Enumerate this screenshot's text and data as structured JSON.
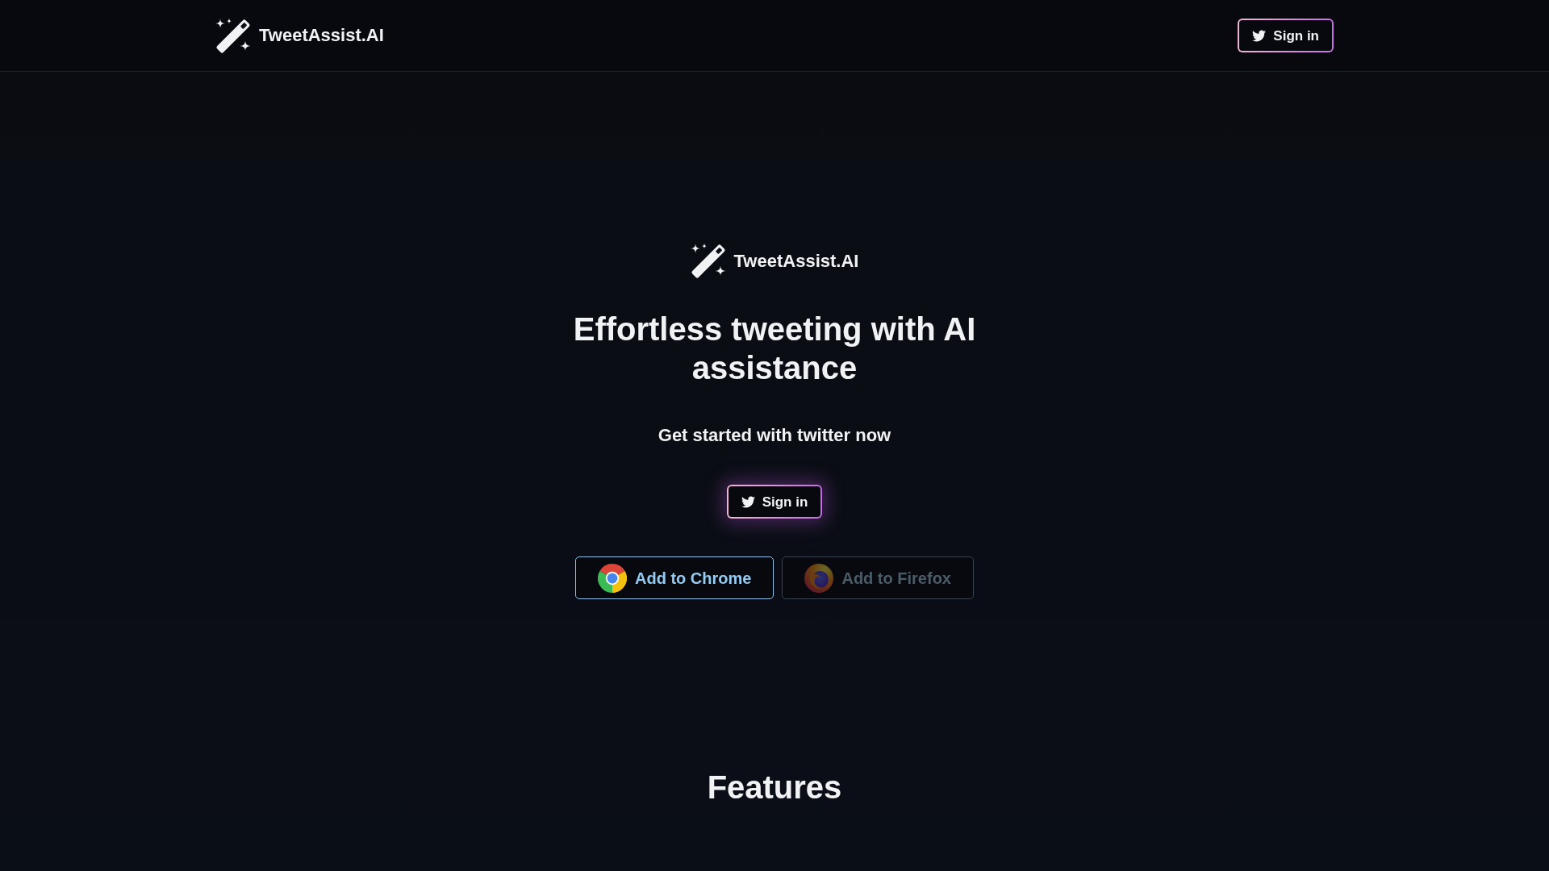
{
  "header": {
    "logo": {
      "name": "TweetAssist.AI"
    },
    "sign_in_button": {
      "label": "Sign in"
    }
  },
  "hero": {
    "logo": {
      "name": "TweetAssist.AI"
    },
    "heading": "Effortless tweeting with AI assistance",
    "subtitle": "Get started with twitter now",
    "sign_in_button": {
      "label": "Sign in"
    },
    "extension_buttons": [
      {
        "kind": "chrome",
        "label": "Add to Chrome",
        "disabled": false
      },
      {
        "kind": "firefox",
        "label": "Add to Firefox",
        "disabled": true
      }
    ]
  },
  "features": {
    "title": "Features"
  }
}
